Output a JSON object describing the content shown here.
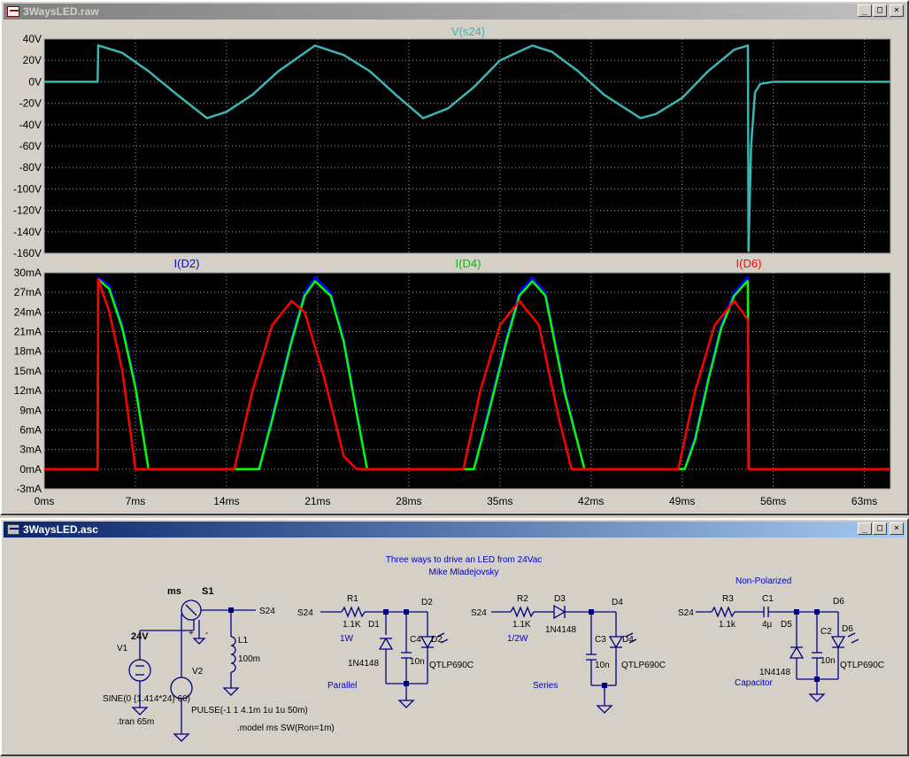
{
  "waveform_window": {
    "title": "3WaysLED.raw",
    "buttons": [
      "_",
      "□",
      "×"
    ],
    "top_pane": {
      "trace_label": "V(s24)",
      "y_ticks": [
        "40V",
        "20V",
        "0V",
        "-20V",
        "-40V",
        "-60V",
        "-80V",
        "-100V",
        "-120V",
        "-140V",
        "-160V"
      ]
    },
    "bottom_pane": {
      "trace_labels": [
        "I(D2)",
        "I(D4)",
        "I(D6)"
      ],
      "y_ticks": [
        "30mA",
        "27mA",
        "24mA",
        "21mA",
        "18mA",
        "15mA",
        "12mA",
        "9mA",
        "6mA",
        "3mA",
        "0mA",
        "-3mA"
      ]
    },
    "x_ticks": [
      "0ms",
      "7ms",
      "14ms",
      "21ms",
      "28ms",
      "35ms",
      "42ms",
      "49ms",
      "56ms",
      "63ms"
    ],
    "colors": {
      "plot_bg": "#000000",
      "grid": "#a0a0a0",
      "axis_text": "#000000",
      "vs24": "#3cb4b4",
      "id2": "#0000ff",
      "id4": "#00ff00",
      "id6": "#ff0000"
    }
  },
  "chart_data": [
    {
      "type": "line",
      "title": "V(s24)",
      "x_unit": "ms",
      "xlim": [
        0,
        65
      ],
      "ylim": [
        -160,
        40
      ],
      "y_unit": "V",
      "series": [
        {
          "name": "V(s24)",
          "color": "#3cb4b4",
          "x": [
            0,
            4.1,
            4.15,
            6,
            8,
            10,
            12.5,
            14,
            16,
            18,
            20.8,
            23,
            25,
            27,
            29.1,
            31,
            33,
            35,
            37.5,
            39,
            41,
            43,
            45.8,
            47,
            49,
            51,
            53,
            54.05,
            54.1,
            54.3,
            54.6,
            55,
            56,
            65
          ],
          "y": [
            0,
            0,
            34,
            27,
            10,
            -10,
            -33.9,
            -28,
            -12,
            10,
            33.9,
            25,
            10,
            -12,
            -33.9,
            -25,
            -5,
            20,
            33.9,
            28,
            10,
            -12,
            -33.9,
            -30,
            -15,
            10,
            30,
            33.9,
            -158,
            -60,
            -10,
            -2,
            0,
            0
          ]
        }
      ]
    },
    {
      "type": "line",
      "title": "",
      "x_unit": "ms",
      "xlim": [
        0,
        65
      ],
      "ylim": [
        -3,
        30
      ],
      "y_unit": "mA",
      "series": [
        {
          "name": "I(D2)",
          "color": "#0000ff",
          "x": [
            0,
            4.1,
            4.15,
            5,
            6,
            7,
            8,
            16.5,
            17.5,
            19,
            20,
            20.8,
            22,
            23,
            24,
            24.8,
            33,
            34,
            35.5,
            36.5,
            37.5,
            38.5,
            40,
            41.5,
            49.2,
            50,
            51,
            52,
            53,
            54,
            54.05,
            54.1,
            65
          ],
          "y": [
            0,
            0,
            29.3,
            28,
            22,
            13,
            0,
            0,
            8,
            20,
            27,
            29.3,
            27,
            20,
            9,
            0,
            0,
            8,
            20,
            27,
            29.3,
            27,
            12,
            0,
            0,
            5,
            14,
            22,
            27,
            29.3,
            29.3,
            0,
            0
          ]
        },
        {
          "name": "I(D4)",
          "color": "#00ff00",
          "x": [
            0,
            4.1,
            4.15,
            5,
            6,
            7,
            8,
            16.5,
            17.5,
            19,
            20,
            20.8,
            22,
            23,
            24,
            24.8,
            33,
            34,
            35.5,
            36.5,
            37.5,
            38.5,
            40,
            41.5,
            49.2,
            50,
            51,
            52,
            53,
            54,
            54.05,
            54.1,
            65
          ],
          "y": [
            0,
            0,
            29,
            27.5,
            21.5,
            12.5,
            0,
            0,
            7.5,
            19.5,
            26.5,
            28.7,
            26.5,
            19.5,
            8.5,
            0,
            0,
            7.5,
            19.5,
            26.5,
            28.7,
            26.5,
            11.5,
            0,
            0,
            4.5,
            13.5,
            21.5,
            26.5,
            28.7,
            28.7,
            0,
            0
          ]
        },
        {
          "name": "I(D6)",
          "color": "#ff0000",
          "x": [
            0,
            4.1,
            4.15,
            5,
            6,
            7,
            14.6,
            16,
            17.5,
            19,
            20,
            21.5,
            23,
            24,
            32.2,
            33.5,
            35,
            36.5,
            38,
            39.5,
            40.5,
            48.7,
            50,
            51.5,
            53,
            54,
            54.05,
            54.1,
            65
          ],
          "y": [
            0,
            0,
            29,
            24,
            15,
            0,
            0,
            12,
            22,
            25.7,
            24,
            14,
            2,
            0,
            0,
            12,
            22,
            25.7,
            22,
            8,
            0,
            0,
            12,
            22,
            25.7,
            23,
            22.5,
            0,
            0
          ]
        }
      ]
    }
  ],
  "schematic_window": {
    "title": "3WaysLED.asc",
    "buttons": [
      "_",
      "□",
      "×"
    ],
    "heading_line1": "Three ways to drive an LED from 24Vac",
    "heading_line2": "Mike Mladejovsky",
    "source": {
      "v1_name": "V1",
      "v1_value": "24V",
      "v1_spec": "SINE(0 {1.414*24} 60)",
      "tran": ".tran 65m",
      "v2_name": "V2",
      "v2_spec": "PULSE(-1 1 4.1m 1u 1u 50m)",
      "switch_name": "S1",
      "switch_model": "ms",
      "model": ".model ms SW(Ron=1m)",
      "l1_name": "L1",
      "l1_value": "100m",
      "net": "S24",
      "plus": "+",
      "minus": "-"
    },
    "parallel": {
      "net": "S24",
      "r_name": "R1",
      "r_value": "1.1K",
      "r_power": "1W",
      "d1_name": "D1",
      "d1_model": "1N4148",
      "c_name": "C4",
      "c_value": "10n",
      "led_name": "D2",
      "led_model": "QTLP690C",
      "node_label": "D2",
      "caption": "Parallel"
    },
    "series": {
      "net": "S24",
      "r_name": "R2",
      "r_value": "1.1K",
      "r_power": "1/2W",
      "d_name": "D3",
      "d_model": "1N4148",
      "c_name": "C3",
      "c_value": "10n",
      "led_name": "D4",
      "led_model": "QTLP690C",
      "node_label": "D4",
      "caption": "Series"
    },
    "capacitor": {
      "header": "Non-Polarized",
      "net": "S24",
      "r_name": "R3",
      "r_value": "1.1k",
      "c1_name": "C1",
      "c1_value": "4µ",
      "d_name": "D5",
      "d_model": "1N4148",
      "c2_name": "C2",
      "c2_value": "10n",
      "led_name": "D6",
      "led_model": "QTLP690C",
      "node_label": "D6",
      "caption": "Capacitor"
    }
  }
}
